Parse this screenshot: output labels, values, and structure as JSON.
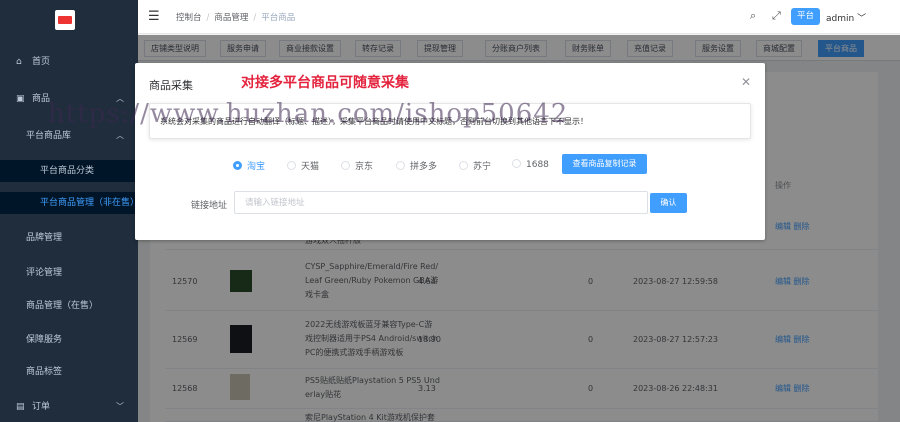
{
  "sidebar": {
    "items": [
      {
        "label": "首页",
        "icon": "home-icon"
      },
      {
        "label": "商品",
        "icon": "box-icon"
      },
      {
        "label": "平台商品库"
      },
      {
        "label": "平台商品分类"
      },
      {
        "label": "平台商品管理（非在售）"
      },
      {
        "label": "品牌管理"
      },
      {
        "label": "评论管理"
      },
      {
        "label": "商品管理（在售）"
      },
      {
        "label": "保障服务"
      },
      {
        "label": "商品标签"
      },
      {
        "label": "订单",
        "icon": "order-icon"
      }
    ]
  },
  "header": {
    "breadcrumb": [
      "控制台",
      "商品管理",
      "平台商品"
    ],
    "platform_label": "平台",
    "user": "admin"
  },
  "tags": [
    "店铺类型说明",
    "服务申请",
    "商业接款设置",
    "转存记录",
    "提现管理",
    "分账商户列表",
    "财务账单",
    "充值记录",
    "服务设置",
    "商城配置",
    "平台商品"
  ],
  "table": {
    "op_header": "操作",
    "edit_label": "编辑",
    "delete_label": "删除",
    "partial_row_name": "游戏双人摇杆版",
    "rows": [
      {
        "id": "12570",
        "name": [
          "CYSP_Sapphire/Emerald/Fire Red/",
          "Leaf Green/Ruby Pokemon GBA游",
          "戏卡盒"
        ],
        "price": "4.64",
        "stock": "0",
        "time": "2023-08-27 12:59:58"
      },
      {
        "id": "12569",
        "name": [
          "2022无线游戏板蓝牙兼容Type-C游",
          "戏控制器适用于PS4 Android/switch",
          "PC的便携式游戏手柄游戏板"
        ],
        "price": "18.90",
        "stock": "0",
        "time": "2023-08-27 12:57:23"
      },
      {
        "id": "12568",
        "name": [
          "PS5贴纸贴纸Playstation 5 PS5 Und",
          "erlay贴花"
        ],
        "price": "3.13",
        "stock": "0",
        "time": "2023-08-26 22:48:31"
      },
      {
        "id": "",
        "name": [
          "索尼PlayStation 4 Kit游戏机保护套"
        ],
        "price": "",
        "stock": "",
        "time": ""
      }
    ]
  },
  "dialog": {
    "title": "商品采集",
    "promo": "对接多平台商品可随意采集",
    "notice": "系统会对采集的商品进行自动翻译（标题、描述），采集平台商品时请使用中文标题，否则前台切换到其他语言下不显示！",
    "platforms": [
      "淘宝",
      "天猫",
      "京东",
      "拼多多",
      "苏宁",
      "1688"
    ],
    "selected_platform": "淘宝",
    "view_records_label": "查看商品复制记录",
    "link_label": "链接地址",
    "link_placeholder": "请输入链接地址",
    "confirm_label": "确认"
  },
  "watermark": "https://www.huzhan.com/ishop50642",
  "colors": {
    "primary": "#409eff",
    "sidebar": "#1f2d3d",
    "promo": "#e4233e"
  }
}
